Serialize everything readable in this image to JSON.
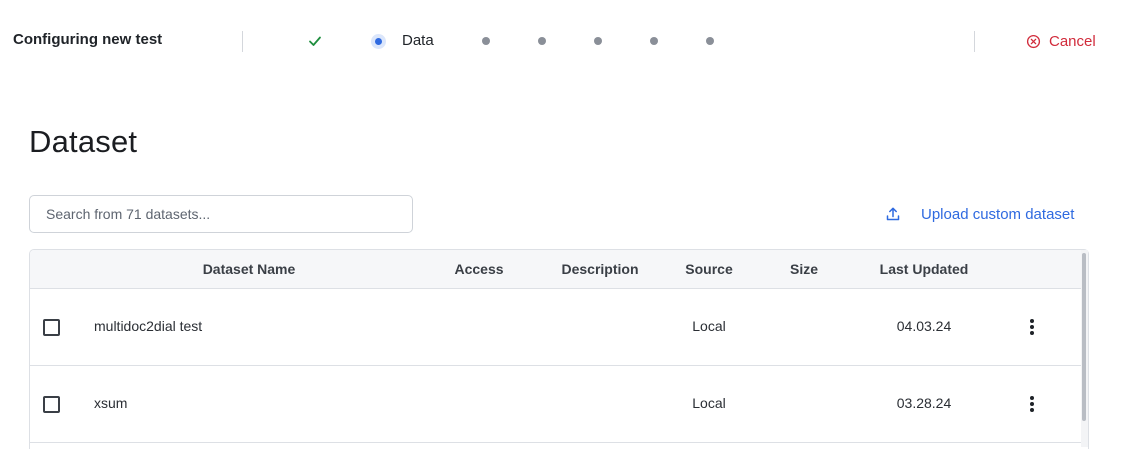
{
  "header": {
    "title": "Configuring new test",
    "steps": {
      "completed_icon": "check-icon",
      "current_label": "Data",
      "remaining_count": 5
    },
    "cancel_label": "Cancel",
    "cancel_icon": "close-circle-icon"
  },
  "page": {
    "title": "Dataset"
  },
  "search": {
    "placeholder": "Search from 71 datasets...",
    "value": ""
  },
  "upload": {
    "label": "Upload custom dataset",
    "icon": "upload-icon"
  },
  "table": {
    "columns": [
      "Dataset Name",
      "Access",
      "Description",
      "Source",
      "Size",
      "Last Updated"
    ],
    "rows": [
      {
        "name": "multidoc2dial test",
        "access": "",
        "description": "",
        "source": "Local",
        "size": "",
        "last_updated": "04.03.24"
      },
      {
        "name": "xsum",
        "access": "",
        "description": "",
        "source": "Local",
        "size": "",
        "last_updated": "03.28.24"
      }
    ]
  },
  "colors": {
    "accent": "#2f6ae0",
    "danger": "#d12b3b",
    "success": "#1e8e3e",
    "header_bg": "#f6f7f9",
    "border": "#dde0e5"
  }
}
